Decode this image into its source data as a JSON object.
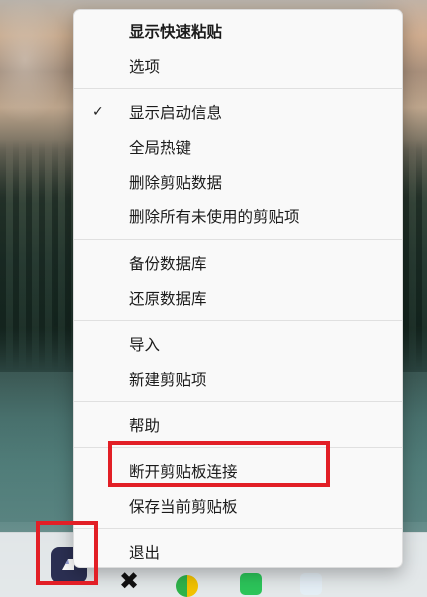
{
  "menu": {
    "items": [
      {
        "label": "显示快速粘贴",
        "bold": true,
        "checked": false
      },
      {
        "label": "选项",
        "bold": false,
        "checked": false
      },
      {
        "label": "显示启动信息",
        "bold": false,
        "checked": true
      },
      {
        "label": "全局热键",
        "bold": false,
        "checked": false
      },
      {
        "label": "删除剪贴数据",
        "bold": false,
        "checked": false
      },
      {
        "label": "删除所有未使用的剪贴项",
        "bold": false,
        "checked": false
      },
      {
        "label": "备份数据库",
        "bold": false,
        "checked": false
      },
      {
        "label": "还原数据库",
        "bold": false,
        "checked": false
      },
      {
        "label": "导入",
        "bold": false,
        "checked": false
      },
      {
        "label": "新建剪贴项",
        "bold": false,
        "checked": false
      },
      {
        "label": "帮助",
        "bold": false,
        "checked": false
      },
      {
        "label": "断开剪贴板连接",
        "bold": false,
        "checked": false
      },
      {
        "label": "保存当前剪贴板",
        "bold": false,
        "checked": false
      },
      {
        "label": "退出",
        "bold": false,
        "checked": false
      }
    ],
    "check_glyph": "✓"
  },
  "taskbar": {
    "icons": [
      "clipboard-app-icon",
      "black-tray-icon",
      "green-yellow-tray-icon",
      "green-tray-icon",
      "light-tray-icon"
    ]
  },
  "colors": {
    "highlight": "#e21f26",
    "menu_background": "#f9f9f9",
    "app_icon": "#2b2f52"
  }
}
